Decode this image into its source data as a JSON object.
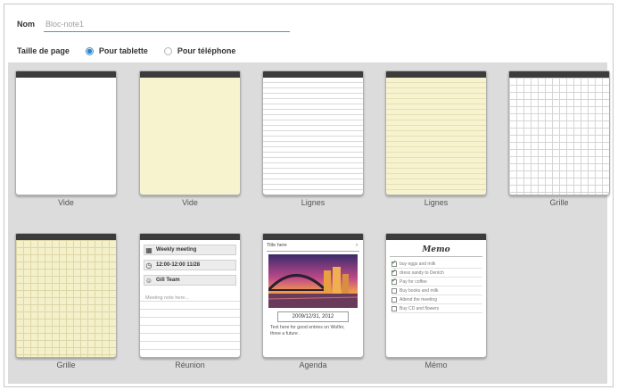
{
  "form": {
    "name_label": "Nom",
    "name_placeholder": "Bloc-note1",
    "size_label": "Taille de page",
    "size_options": [
      {
        "label": "Pour tablette",
        "selected": true
      },
      {
        "label": "Pour téléphone",
        "selected": false
      }
    ]
  },
  "templates": [
    {
      "caption": "Vide"
    },
    {
      "caption": "Vide"
    },
    {
      "caption": "Lignes"
    },
    {
      "caption": "Lignes"
    },
    {
      "caption": "Grille"
    },
    {
      "caption": "Grille"
    },
    {
      "caption": "Réunion"
    },
    {
      "caption": "Agenda"
    },
    {
      "caption": "Mémo"
    }
  ],
  "meeting_preview": {
    "title": "Weekly meeting",
    "time": "12:00-12:00 11/28",
    "team": "Gill Team",
    "notes": "Meeting note here..."
  },
  "agenda_preview": {
    "header": "Title here",
    "date": "2009/12/31, 2012",
    "text": "Text here for good entries on Wolfer, three a future ."
  },
  "memo_preview": {
    "title": "Memo",
    "items": [
      {
        "text": "buy eggs and milk",
        "checked": true
      },
      {
        "text": "dress sandy to Dentch",
        "checked": true
      },
      {
        "text": "Pay for coffee",
        "checked": true
      },
      {
        "text": "Buy books and milk",
        "checked": false
      },
      {
        "text": "Attend the meeting",
        "checked": false
      },
      {
        "text": "Buy CD and flowers",
        "checked": false
      }
    ]
  },
  "colors": {
    "accent": "#2e86cf",
    "paper_yellow": "#f7f3cf",
    "gallery_bg": "#dcdcdc",
    "page_topbar": "#3c3c3c"
  }
}
